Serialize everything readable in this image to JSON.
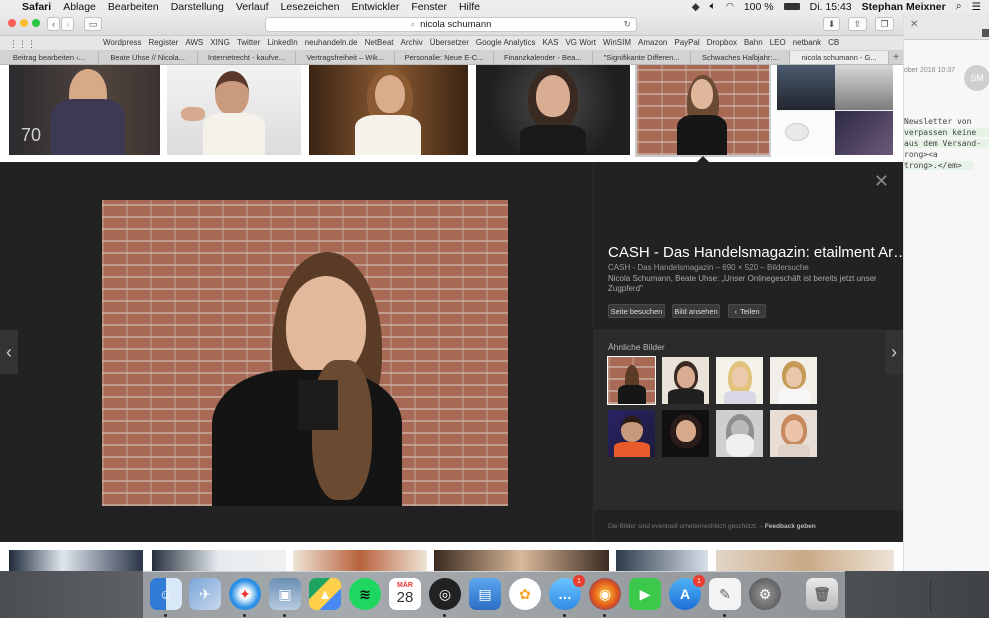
{
  "menubar": {
    "app": "Safari",
    "items": [
      "Ablage",
      "Bearbeiten",
      "Darstellung",
      "Verlauf",
      "Lesezeichen",
      "Entwickler",
      "Fenster",
      "Hilfe"
    ],
    "battery": "100 %",
    "clock": "Di. 15:43",
    "user": "Stephan Meixner"
  },
  "browser": {
    "url": "nicola schumann",
    "favorites": [
      "Wordpress",
      "Register",
      "AWS",
      "XING",
      "Twitter",
      "LinkedIn",
      "neuhandeln.de",
      "NetBeat",
      "Archiv",
      "Übersetzer",
      "Google Analytics",
      "KAS",
      "VG Wort",
      "WinSIM",
      "Amazon",
      "PayPal",
      "Dropbox",
      "Bahn",
      "LEO",
      "netbank",
      "CB"
    ],
    "tabs": [
      "Beitrag bearbeiten ‹...",
      "Beate Uhse // Nicola...",
      "Internetrecht - kaufve...",
      "Vertragsfreiheit – Wik...",
      "Personalie: Neue E-C...",
      "Finanzkalender - Bea...",
      "\"Signifikante Differen...",
      "Schwaches Halbjahr:...",
      "nicola schumann - G..."
    ],
    "active_tab": 8
  },
  "detail": {
    "title": "CASH - Das Handelsmagazin: etailment Ar…",
    "meta": "CASH - Das Handelsmagazin – 690 × 520 – Bildersuche",
    "description": "Nicola Schumann, Beate Uhse: „Unser Onlinegeschäft ist bereits jetzt unser Zugpferd\"",
    "buttons": {
      "visit": "Seite besuchen",
      "view": "Bild ansehen",
      "share": "Teilen"
    },
    "similar_title": "Ähnliche Bilder",
    "footer": "Die Bilder sind eventuell urheberrechtlich geschützt.",
    "feedback": "Feedback geben"
  },
  "sidewindow": {
    "date": "ober 2016 10:37",
    "avatar": "SM",
    "code_lines": [
      " Newsletter von",
      "verpassen keine",
      "aus dem Versand-",
      "rong><a",
      "trong>.</em>"
    ]
  },
  "dock": {
    "calendar_month": "MÄR",
    "calendar_day": "28",
    "messages_badge": "1",
    "appstore_badge": "1"
  }
}
